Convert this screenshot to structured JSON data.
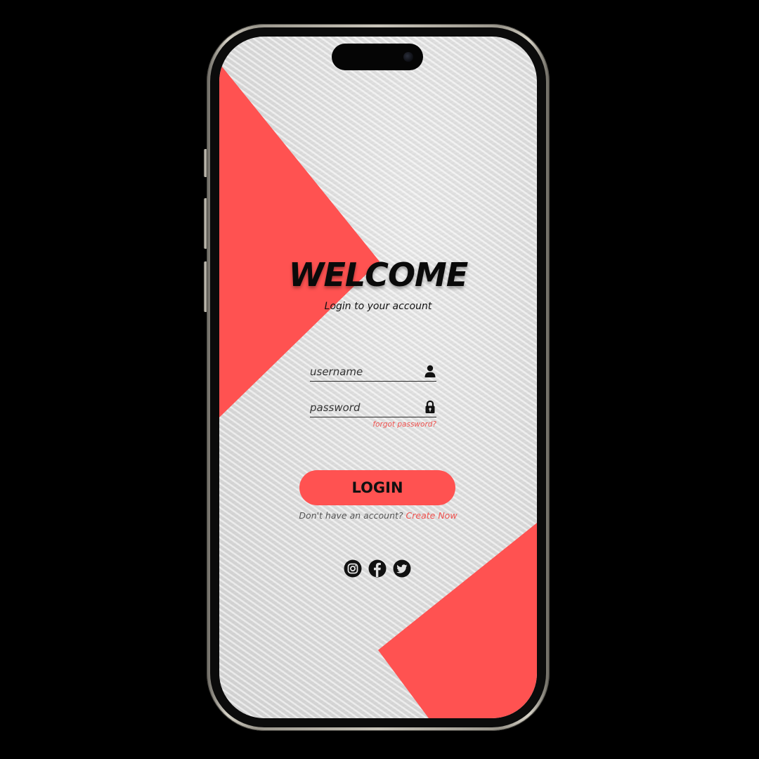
{
  "theme": {
    "accent": "#ff5251",
    "link": "#ef5350",
    "screen_background": "#e2e2e2",
    "text": "#0a0a0a"
  },
  "header": {
    "title": "WELCOME",
    "subtitle": "Login to your account"
  },
  "form": {
    "username": {
      "value": "",
      "placeholder": "username",
      "icon": "user-icon"
    },
    "password": {
      "value": "",
      "placeholder": "password",
      "icon": "lock-icon"
    },
    "forgot_password": "forgot password?",
    "login_label": "LOGIN"
  },
  "signup": {
    "prompt": "Don't have an account?",
    "link": "Create Now"
  },
  "social": [
    {
      "name": "instagram-icon"
    },
    {
      "name": "facebook-icon"
    },
    {
      "name": "twitter-icon"
    }
  ]
}
